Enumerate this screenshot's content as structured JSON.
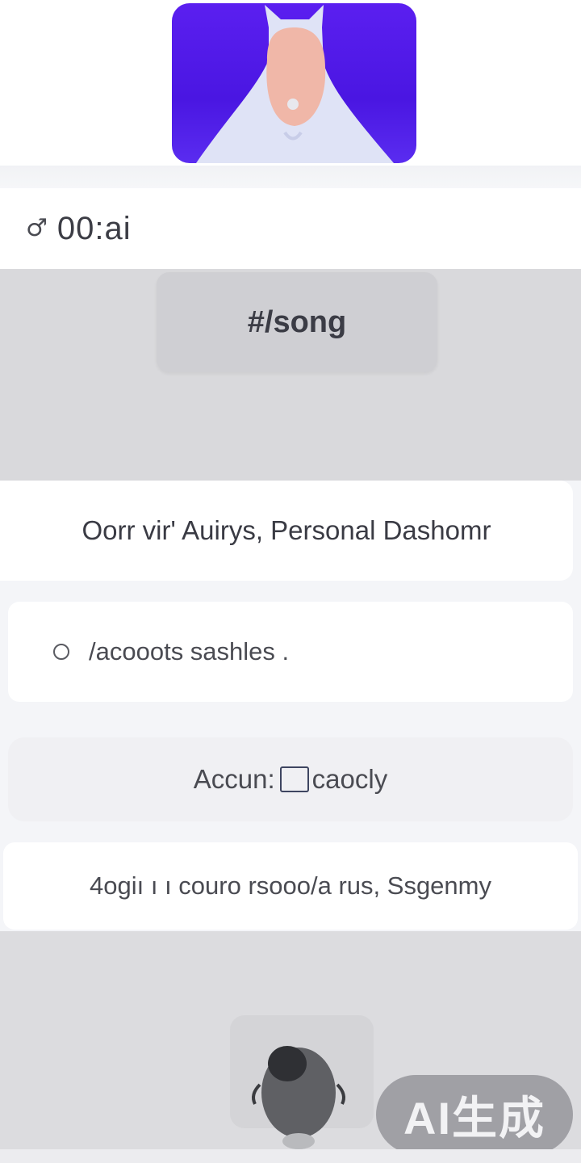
{
  "header": {
    "icon": "alarm-icon",
    "icon_glyph": "♂",
    "time_text": "00:ai"
  },
  "center_button": {
    "label": "#/song"
  },
  "title_card": {
    "text": "Oorr vir' Auirys, Personal Dashomr"
  },
  "accounts_option": {
    "label": "/acooots sashles ."
  },
  "account_toggle": {
    "label_left": "Accun:",
    "label_right": "caocly"
  },
  "footer_card": {
    "text": "4ogiı ı ı couro rsooo/a rus, Ssgenmy"
  },
  "watermark": {
    "text": "AI生成"
  },
  "colors": {
    "hero_purple": "#4a16e2",
    "gray_section": "#d9d9dc"
  }
}
